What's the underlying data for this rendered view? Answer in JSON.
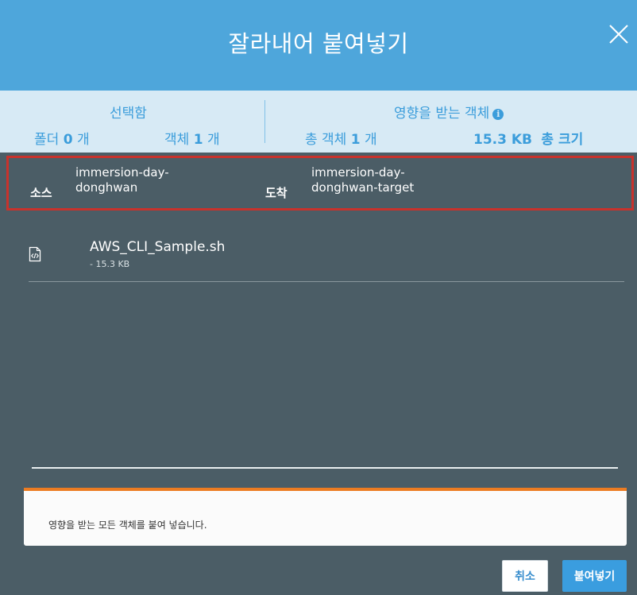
{
  "dialog": {
    "title": "잘라내어 붙여넣기"
  },
  "summary": {
    "selected_heading": "선택함",
    "folders_label": "폴더",
    "folders_count": "0",
    "objects_label": "객체",
    "objects_count": "1",
    "unit": "개",
    "affected_heading": "영향을 받는 객체",
    "total_objects_label": "총 객체",
    "total_objects_count": "1",
    "total_size": "15.3 KB",
    "total_size_label": "총 크기"
  },
  "path": {
    "source_label": "소스",
    "source_line1": "immersion-day-",
    "source_line2": "donghwan",
    "dest_label": "도착",
    "dest_line1": "immersion-day-",
    "dest_line2": "donghwan-target"
  },
  "files": [
    {
      "name": "AWS_CLI_Sample.sh",
      "size": "- 15.3 KB"
    }
  ],
  "notice": {
    "text": "영향을 받는 모든 객체를 붙여 넣습니다."
  },
  "buttons": {
    "cancel": "취소",
    "paste": "붙여넣기"
  },
  "colors": {
    "header": "#4ea6db",
    "summary_bg": "#d7eaf5",
    "accent_text": "#3b9ddb",
    "body_bg": "#4b5d66",
    "highlight_border": "#c8322c",
    "notice_accent": "#ec7c22"
  },
  "icons": {
    "close": "close-icon",
    "info": "info-icon",
    "file": "code-file-icon"
  }
}
